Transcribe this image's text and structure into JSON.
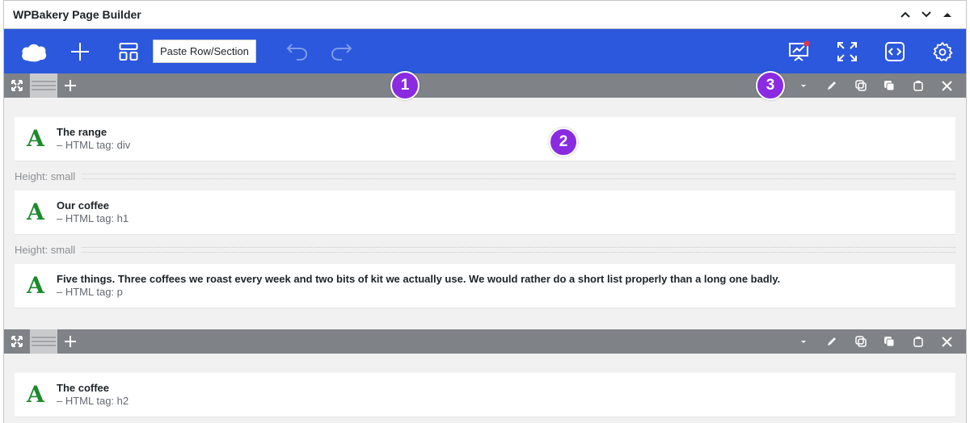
{
  "panel": {
    "title": "WPBakery Page Builder"
  },
  "toolbar": {
    "paste_label": "Paste Row/Section",
    "icons": [
      "wpbakery-logo-icon",
      "plus-icon",
      "templates-icon",
      "undo-icon",
      "redo-icon",
      "preview-icon",
      "fullscreen-icon",
      "custom-code-icon",
      "settings-icon"
    ],
    "accent_color": "#2b58dc"
  },
  "rows": [
    {
      "elements": [
        {
          "title": "The range",
          "subtitle": "– HTML tag: div",
          "icon": "A"
        },
        {
          "spacer": "Height: small"
        },
        {
          "title": "Our coffee",
          "subtitle": "– HTML tag: h1",
          "icon": "A"
        },
        {
          "spacer": "Height: small"
        },
        {
          "title": "Five things. Three coffees we roast every week and two bits of kit we actually use. We would rather do a short list properly than a long one badly.",
          "subtitle": "– HTML tag: p",
          "icon": "A"
        }
      ]
    },
    {
      "elements": [
        {
          "title": "The coffee",
          "subtitle": "– HTML tag: h2",
          "icon": "A"
        }
      ]
    }
  ],
  "badges": [
    "1",
    "2",
    "3"
  ],
  "badge_color": "#8a2be2"
}
